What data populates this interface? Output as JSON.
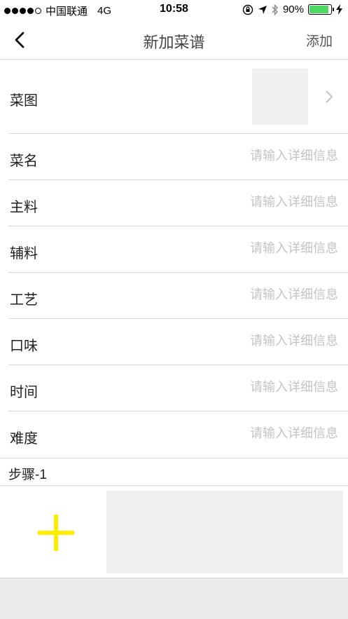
{
  "status_bar": {
    "carrier": "中国联通",
    "network": "4G",
    "time": "10:58",
    "battery": "90%",
    "battery_level": 0.9,
    "battery_color": "#4cd964"
  },
  "nav": {
    "back_icon": "chevron-left-icon",
    "title": "新加菜谱",
    "add_label": "添加"
  },
  "photo_row": {
    "label": "菜图",
    "chevron_icon": "chevron-right-icon"
  },
  "fields": [
    {
      "label": "菜名",
      "placeholder": "请输入详细信息"
    },
    {
      "label": "主料",
      "placeholder": "请输入详细信息"
    },
    {
      "label": "辅料",
      "placeholder": "请输入详细信息"
    },
    {
      "label": "工艺",
      "placeholder": "请输入详细信息"
    },
    {
      "label": "口味",
      "placeholder": "请输入详细信息"
    },
    {
      "label": "时间",
      "placeholder": "请输入详细信息"
    },
    {
      "label": "难度",
      "placeholder": "请输入详细信息"
    }
  ],
  "step": {
    "label": "步骤-1",
    "add_icon": "plus-icon",
    "accent_color": "#ffee00"
  }
}
